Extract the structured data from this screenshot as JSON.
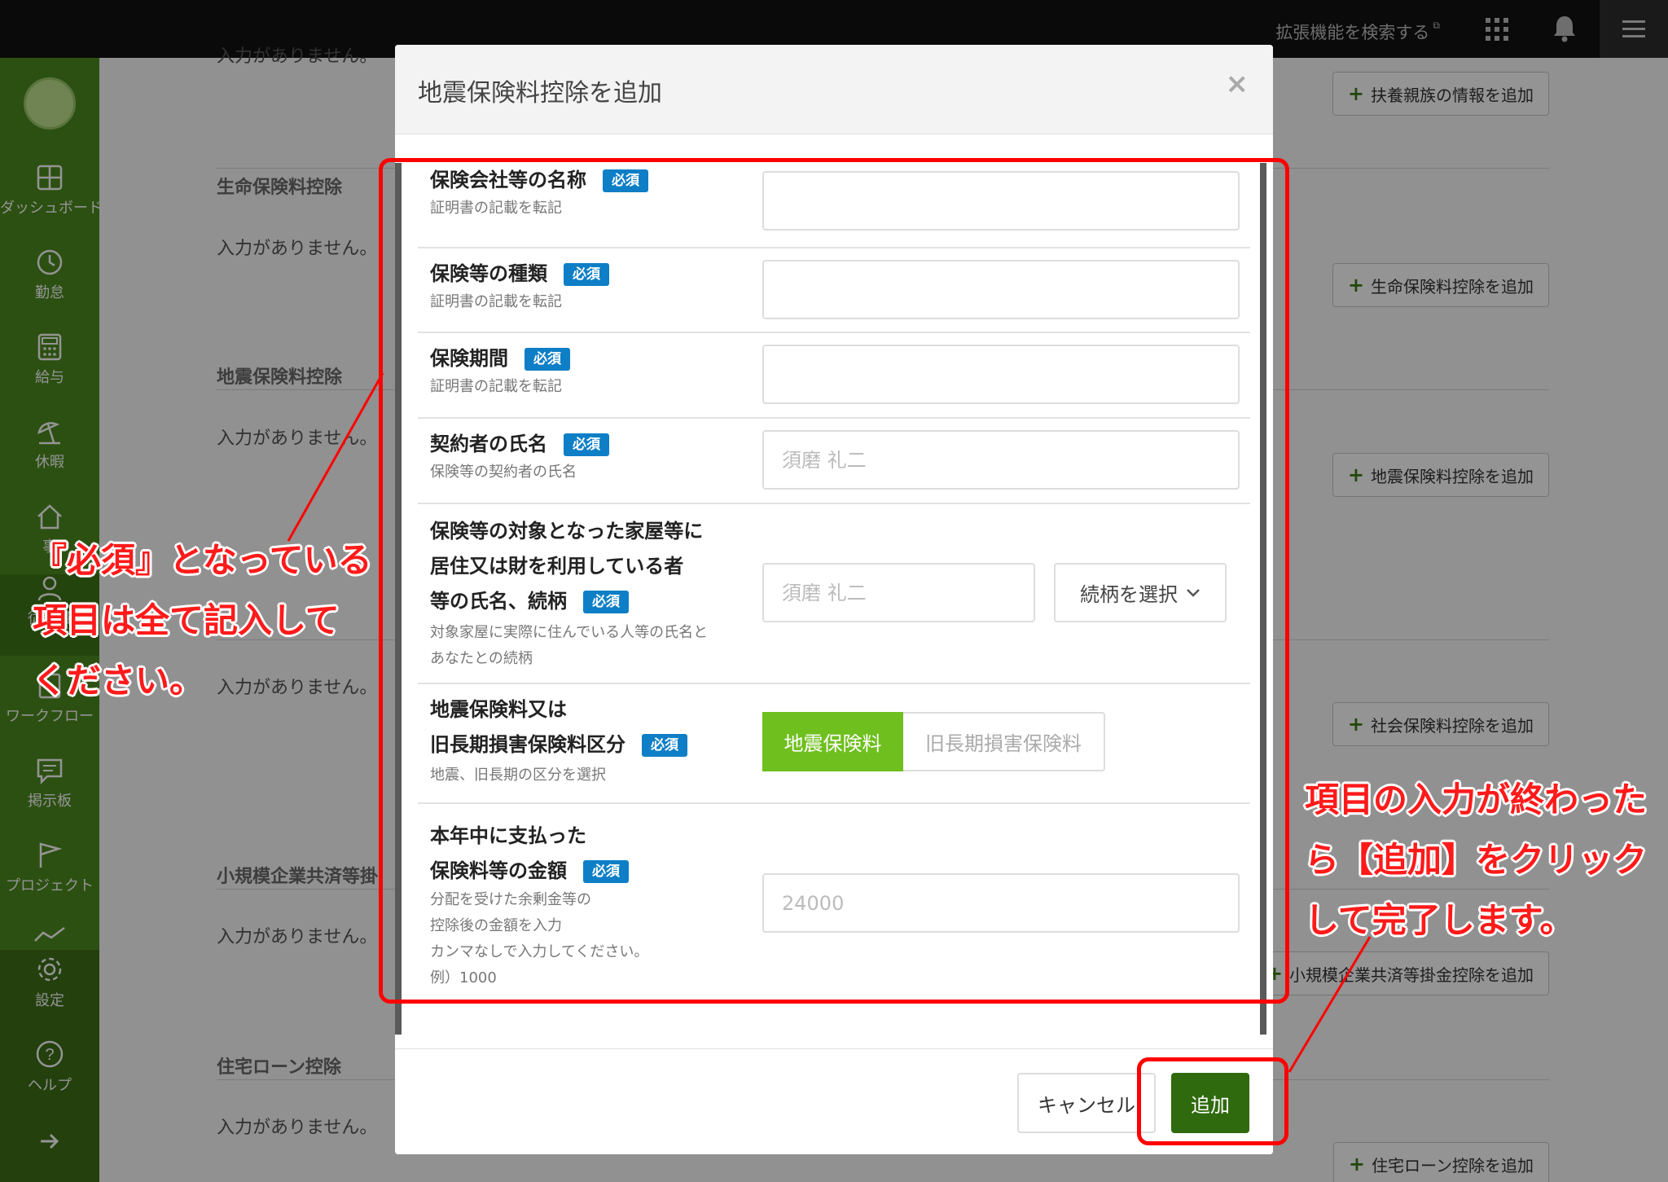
{
  "topbar": {
    "extension_search_label": "拡張機能を検索する",
    "external_mark": "⧉"
  },
  "sidebar": {
    "items": [
      {
        "label": "ダッシュボード",
        "icon": "dashboard-icon"
      },
      {
        "label": "勤怠",
        "icon": "clock-icon"
      },
      {
        "label": "給与",
        "icon": "calculator-icon"
      },
      {
        "label": "休暇",
        "icon": "beach-umbrella-icon"
      },
      {
        "label": "事",
        "icon": "home-icon"
      },
      {
        "label": "従業員",
        "icon": "employee-icon"
      },
      {
        "label": "ワークフロー",
        "icon": "workflow-icon"
      },
      {
        "label": "掲示板",
        "icon": "message-board-icon"
      },
      {
        "label": "プロジェクト",
        "icon": "flag-icon"
      },
      {
        "label": "設定",
        "icon": "gear-icon"
      },
      {
        "label": "ヘルプ",
        "icon": "help-icon"
      }
    ],
    "expand_icon": "arrow-right-icon"
  },
  "background": {
    "top_empty_text": "入力がありません。",
    "add_dependents_label": "扶養親族の情報を追加",
    "sections": [
      {
        "title": "生命保険料控除",
        "empty_text": "入力がありません。",
        "add_label": "生命保険料控除を追加"
      },
      {
        "title": "地震保険料控除",
        "empty_text": "入力がありません。",
        "add_label": "地震保険料控除を追加"
      },
      {
        "title": "",
        "empty_text": "入力がありません。",
        "add_label": "社会保険料控除を追加"
      },
      {
        "title": "小規模企業共済等掛",
        "empty_text": "入力がありません。",
        "add_label": "小規模企業共済等掛金控除を追加"
      },
      {
        "title": "住宅ローン控除",
        "empty_text": "入力がありません。",
        "add_label": "住宅ローン控除を追加"
      }
    ]
  },
  "modal": {
    "title": "地震保険料控除を追加",
    "close_glyph": "×",
    "required_badge": "必須",
    "fields": [
      {
        "label": "保険会社等の名称",
        "hint": "証明書の記載を転記",
        "value": "",
        "placeholder": ""
      },
      {
        "label": "保険等の種類",
        "hint": "証明書の記載を転記",
        "value": "",
        "placeholder": ""
      },
      {
        "label": "保険期間",
        "hint": "証明書の記載を転記",
        "value": "",
        "placeholder": ""
      },
      {
        "label": "契約者の氏名",
        "hint": "保険等の契約者の氏名",
        "value": "",
        "placeholder": "須磨 礼二"
      }
    ],
    "resident": {
      "label_lines": [
        "保険等の対象となった家屋等に",
        "居住又は財を利用している者",
        "等の氏名、続柄"
      ],
      "hint_lines": [
        "対象家屋に実際に住んでいる人等の氏名と",
        "あなたとの続柄"
      ],
      "name_placeholder": "須磨 礼二",
      "relation_select_label": "続柄を選択"
    },
    "category": {
      "label_lines": [
        "地震保険料又は",
        "旧長期損害保険料区分"
      ],
      "hint": "地震、旧長期の区分を選択",
      "options": [
        "地震保険料",
        "旧長期損害保険料"
      ],
      "selected": "地震保険料"
    },
    "amount": {
      "label_lines": [
        "本年中に支払った",
        "保険料等の金額"
      ],
      "hint_lines": [
        "分配を受けた余剰金等の",
        "控除後の金額を入力",
        "カンマなしで入力してください。",
        "例）1000"
      ],
      "placeholder": "24000"
    },
    "cancel_label": "キャンセル",
    "submit_label": "追加"
  },
  "annotations": {
    "required_note_lines": [
      "『必須』となっている",
      "項目は全て記入して",
      "ください。"
    ],
    "submit_note_lines": [
      "項目の入力が終わった",
      "ら【追加】をクリック",
      "して完了します。"
    ]
  },
  "colors": {
    "sidebar_green": "#4d8a1f",
    "required_badge_blue": "#0e7fc6",
    "selected_segment_green": "#6fbf1f",
    "submit_button_green": "#2f6a0e",
    "annotation_red": "#ff0000"
  }
}
